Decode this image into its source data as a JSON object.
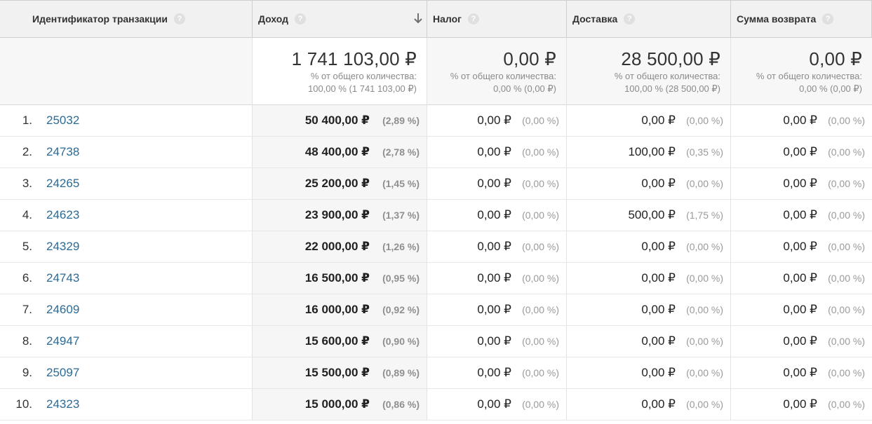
{
  "headers": {
    "transaction_id": "Идентификатор транзакции",
    "revenue": "Доход",
    "tax": "Налог",
    "shipping": "Доставка",
    "refund": "Сумма возврата",
    "help_glyph": "?"
  },
  "totals": {
    "revenue": {
      "value": "1 741 103,00 ₽",
      "label": "% от общего количества:",
      "share": "100,00 % (1 741 103,00 ₽)"
    },
    "tax": {
      "value": "0,00 ₽",
      "label": "% от общего количества:",
      "share": "0,00 % (0,00 ₽)"
    },
    "shipping": {
      "value": "28 500,00 ₽",
      "label": "% от общего количества:",
      "share": "100,00 % (28 500,00 ₽)"
    },
    "refund": {
      "value": "0,00 ₽",
      "label": "% от общего количества:",
      "share": "0,00 % (0,00 ₽)"
    }
  },
  "rows": [
    {
      "n": "1.",
      "id": "25032",
      "revenue": "50 400,00 ₽",
      "revenue_pct": "(2,89 %)",
      "tax": "0,00 ₽",
      "tax_pct": "(0,00 %)",
      "shipping": "0,00 ₽",
      "shipping_pct": "(0,00 %)",
      "refund": "0,00 ₽",
      "refund_pct": "(0,00 %)"
    },
    {
      "n": "2.",
      "id": "24738",
      "revenue": "48 400,00 ₽",
      "revenue_pct": "(2,78 %)",
      "tax": "0,00 ₽",
      "tax_pct": "(0,00 %)",
      "shipping": "100,00 ₽",
      "shipping_pct": "(0,35 %)",
      "refund": "0,00 ₽",
      "refund_pct": "(0,00 %)"
    },
    {
      "n": "3.",
      "id": "24265",
      "revenue": "25 200,00 ₽",
      "revenue_pct": "(1,45 %)",
      "tax": "0,00 ₽",
      "tax_pct": "(0,00 %)",
      "shipping": "0,00 ₽",
      "shipping_pct": "(0,00 %)",
      "refund": "0,00 ₽",
      "refund_pct": "(0,00 %)"
    },
    {
      "n": "4.",
      "id": "24623",
      "revenue": "23 900,00 ₽",
      "revenue_pct": "(1,37 %)",
      "tax": "0,00 ₽",
      "tax_pct": "(0,00 %)",
      "shipping": "500,00 ₽",
      "shipping_pct": "(1,75 %)",
      "refund": "0,00 ₽",
      "refund_pct": "(0,00 %)"
    },
    {
      "n": "5.",
      "id": "24329",
      "revenue": "22 000,00 ₽",
      "revenue_pct": "(1,26 %)",
      "tax": "0,00 ₽",
      "tax_pct": "(0,00 %)",
      "shipping": "0,00 ₽",
      "shipping_pct": "(0,00 %)",
      "refund": "0,00 ₽",
      "refund_pct": "(0,00 %)"
    },
    {
      "n": "6.",
      "id": "24743",
      "revenue": "16 500,00 ₽",
      "revenue_pct": "(0,95 %)",
      "tax": "0,00 ₽",
      "tax_pct": "(0,00 %)",
      "shipping": "0,00 ₽",
      "shipping_pct": "(0,00 %)",
      "refund": "0,00 ₽",
      "refund_pct": "(0,00 %)"
    },
    {
      "n": "7.",
      "id": "24609",
      "revenue": "16 000,00 ₽",
      "revenue_pct": "(0,92 %)",
      "tax": "0,00 ₽",
      "tax_pct": "(0,00 %)",
      "shipping": "0,00 ₽",
      "shipping_pct": "(0,00 %)",
      "refund": "0,00 ₽",
      "refund_pct": "(0,00 %)"
    },
    {
      "n": "8.",
      "id": "24947",
      "revenue": "15 600,00 ₽",
      "revenue_pct": "(0,90 %)",
      "tax": "0,00 ₽",
      "tax_pct": "(0,00 %)",
      "shipping": "0,00 ₽",
      "shipping_pct": "(0,00 %)",
      "refund": "0,00 ₽",
      "refund_pct": "(0,00 %)"
    },
    {
      "n": "9.",
      "id": "25097",
      "revenue": "15 500,00 ₽",
      "revenue_pct": "(0,89 %)",
      "tax": "0,00 ₽",
      "tax_pct": "(0,00 %)",
      "shipping": "0,00 ₽",
      "shipping_pct": "(0,00 %)",
      "refund": "0,00 ₽",
      "refund_pct": "(0,00 %)"
    },
    {
      "n": "10.",
      "id": "24323",
      "revenue": "15 000,00 ₽",
      "revenue_pct": "(0,86 %)",
      "tax": "0,00 ₽",
      "tax_pct": "(0,00 %)",
      "shipping": "0,00 ₽",
      "shipping_pct": "(0,00 %)",
      "refund": "0,00 ₽",
      "refund_pct": "(0,00 %)"
    }
  ],
  "icons": {
    "help": "help-circle-icon",
    "sort": "arrow-down-icon"
  },
  "colors": {
    "link": "#2b6a94",
    "header_bg": "#f1f1f1",
    "muted": "#9a9a9a"
  }
}
